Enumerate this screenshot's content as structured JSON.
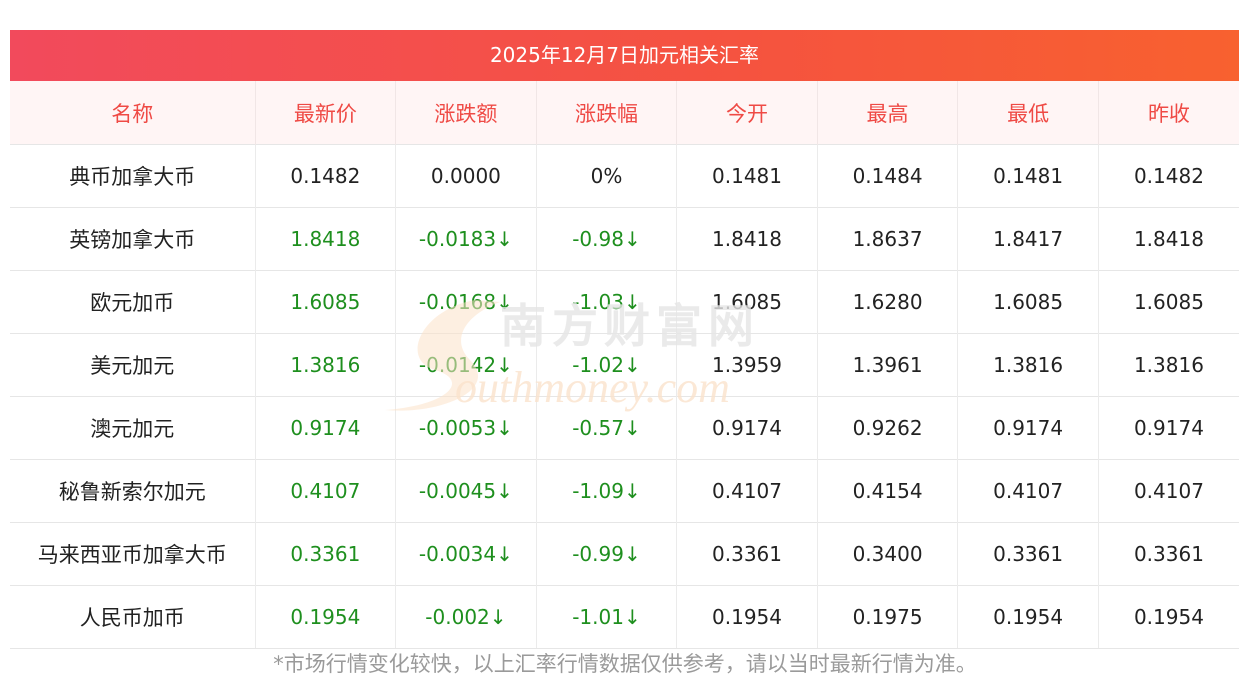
{
  "title": "2025年12月7日加元相关汇率",
  "headers": [
    "名称",
    "最新价",
    "涨跌额",
    "涨跌幅",
    "今开",
    "最高",
    "最低",
    "昨收"
  ],
  "rows": [
    {
      "name": "典币加拿大币",
      "latest": "0.1482",
      "change": "0.0000",
      "pct": "0%",
      "open": "0.1481",
      "high": "0.1484",
      "low": "0.1481",
      "prev": "0.1482",
      "trend": "flat"
    },
    {
      "name": "英镑加拿大币",
      "latest": "1.8418",
      "change": "-0.0183↓",
      "pct": "-0.98↓",
      "open": "1.8418",
      "high": "1.8637",
      "low": "1.8417",
      "prev": "1.8418",
      "trend": "down"
    },
    {
      "name": "欧元加币",
      "latest": "1.6085",
      "change": "-0.0168↓",
      "pct": "-1.03↓",
      "open": "1.6085",
      "high": "1.6280",
      "low": "1.6085",
      "prev": "1.6085",
      "trend": "down"
    },
    {
      "name": "美元加元",
      "latest": "1.3816",
      "change": "-0.0142↓",
      "pct": "-1.02↓",
      "open": "1.3959",
      "high": "1.3961",
      "low": "1.3816",
      "prev": "1.3816",
      "trend": "down"
    },
    {
      "name": "澳元加元",
      "latest": "0.9174",
      "change": "-0.0053↓",
      "pct": "-0.57↓",
      "open": "0.9174",
      "high": "0.9262",
      "low": "0.9174",
      "prev": "0.9174",
      "trend": "down"
    },
    {
      "name": "秘鲁新索尔加元",
      "latest": "0.4107",
      "change": "-0.0045↓",
      "pct": "-1.09↓",
      "open": "0.4107",
      "high": "0.4154",
      "low": "0.4107",
      "prev": "0.4107",
      "trend": "down"
    },
    {
      "name": "马来西亚币加拿大币",
      "latest": "0.3361",
      "change": "-0.0034↓",
      "pct": "-0.99↓",
      "open": "0.3361",
      "high": "0.3400",
      "low": "0.3361",
      "prev": "0.3361",
      "trend": "down"
    },
    {
      "name": "人民币加币",
      "latest": "0.1954",
      "change": "-0.002↓",
      "pct": "-1.01↓",
      "open": "0.1954",
      "high": "0.1975",
      "low": "0.1954",
      "prev": "0.1954",
      "trend": "down"
    }
  ],
  "footer": "*市场行情变化较快，以上汇率行情数据仅供参考，请以当时最新行情为准。",
  "watermark": {
    "cn": "南方财富网",
    "en": "outhmoney.com"
  },
  "colors": {
    "header_gradient_start": "#f24a5c",
    "header_gradient_end": "#f8612f",
    "header_text": "#ef4a45",
    "down": "#1e8f1e"
  }
}
